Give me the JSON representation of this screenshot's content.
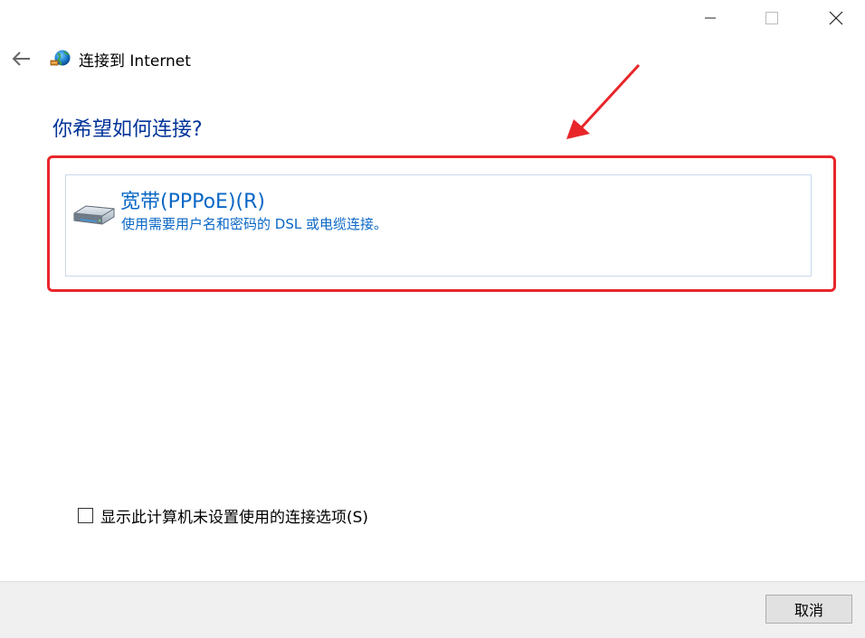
{
  "window": {
    "title": "连接到 Internet",
    "controls": {
      "minimize": "minimize-icon",
      "maximize": "maximize-icon",
      "close": "close-icon"
    }
  },
  "header": {
    "back_icon": "back-arrow-icon",
    "app_icon": "globe-network-icon"
  },
  "main": {
    "question": "你希望如何连接?",
    "options": [
      {
        "icon": "modem-icon",
        "title": "宽带(PPPoE)(R)",
        "description": "使用需要用户名和密码的 DSL 或电缆连接。"
      }
    ],
    "show_all_options_label": "显示此计算机未设置使用的连接选项(S)",
    "show_all_options_checked": false
  },
  "footer": {
    "cancel_label": "取消"
  },
  "annotation": {
    "highlight_color": "#e8262a"
  },
  "colors": {
    "heading": "#003399",
    "link_blue": "#0a67c6",
    "footer_bg": "#f0f0f0"
  }
}
